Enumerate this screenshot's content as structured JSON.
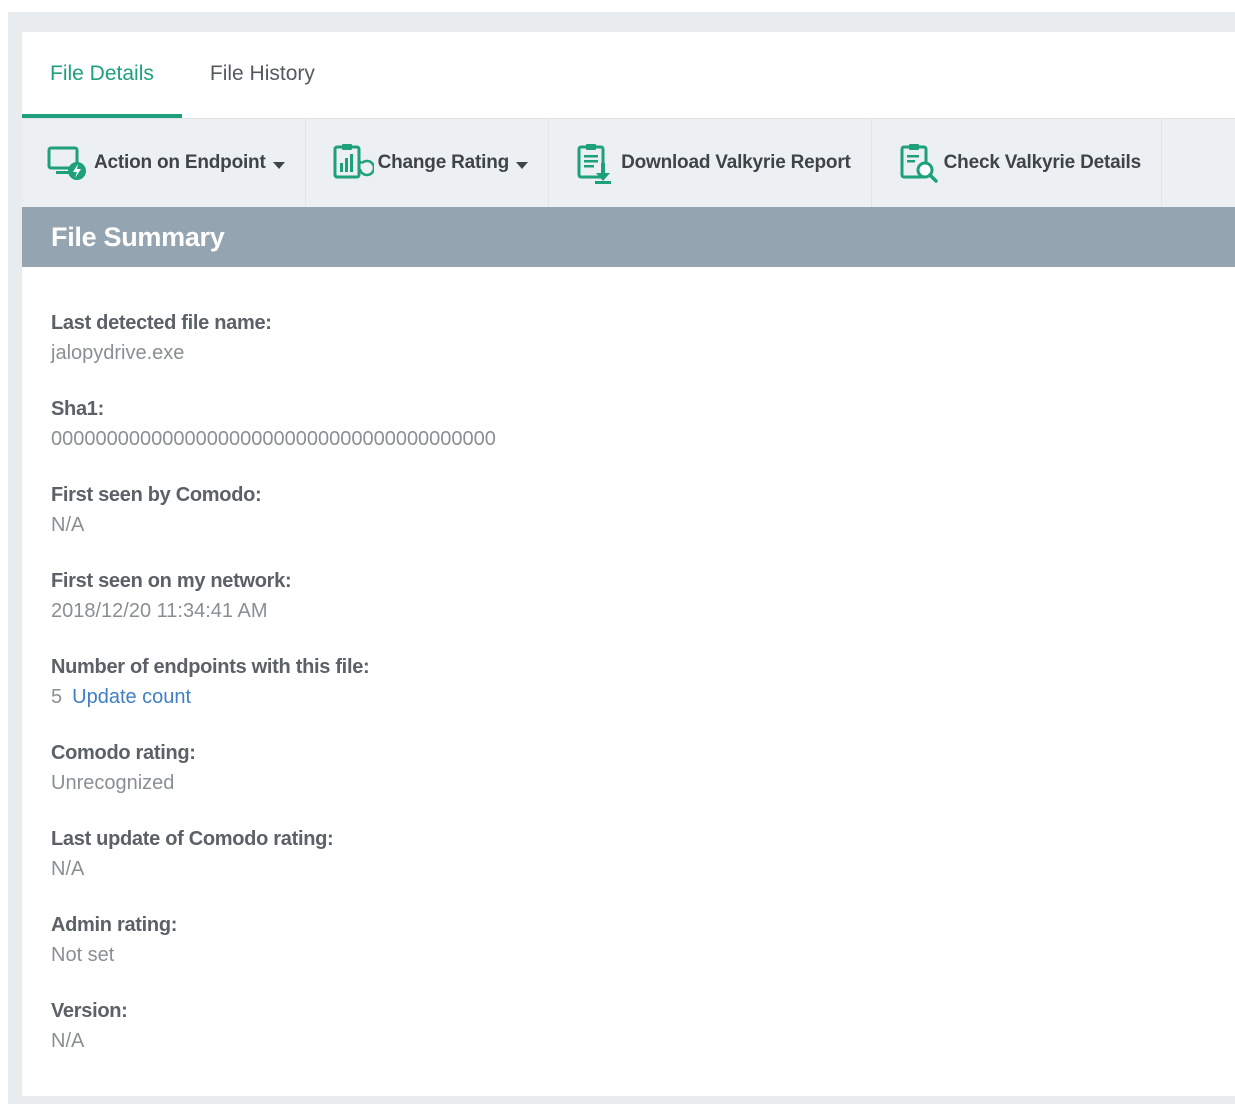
{
  "tabs": [
    {
      "label": "File Details",
      "active": true
    },
    {
      "label": "File History",
      "active": false
    }
  ],
  "toolbar": {
    "action_on_endpoint": "Action on Endpoint",
    "change_rating": "Change Rating",
    "download_valkyrie_report": "Download Valkyrie Report",
    "check_valkyrie_details": "Check Valkyrie Details"
  },
  "section": {
    "title": "File Summary"
  },
  "fields": {
    "last_detected_file_name": {
      "label": "Last detected file name:",
      "value": "jalopydrive.exe"
    },
    "sha1": {
      "label": "Sha1:",
      "value": "0000000000000000000000000000000000000000"
    },
    "first_seen_by_comodo": {
      "label": "First seen by Comodo:",
      "value": "N/A"
    },
    "first_seen_on_network": {
      "label": "First seen on my network:",
      "value": "2018/12/20 11:34:41 AM"
    },
    "endpoints_count": {
      "label": "Number of endpoints with this file:",
      "value": "5",
      "link": "Update count"
    },
    "comodo_rating": {
      "label": "Comodo rating:",
      "value": "Unrecognized"
    },
    "last_update_rating": {
      "label": "Last update of Comodo rating:",
      "value": "N/A"
    },
    "admin_rating": {
      "label": "Admin rating:",
      "value": "Not set"
    },
    "version": {
      "label": "Version:",
      "value": "N/A"
    }
  },
  "colors": {
    "accent": "#1ea07c",
    "header_bg": "#95a4b1",
    "link": "#3f7fc2"
  },
  "icons": {
    "action_on_endpoint": "monitor-shield-icon",
    "change_rating": "chart-refresh-icon",
    "download_valkyrie_report": "clipboard-download-icon",
    "check_valkyrie_details": "clipboard-search-icon"
  }
}
